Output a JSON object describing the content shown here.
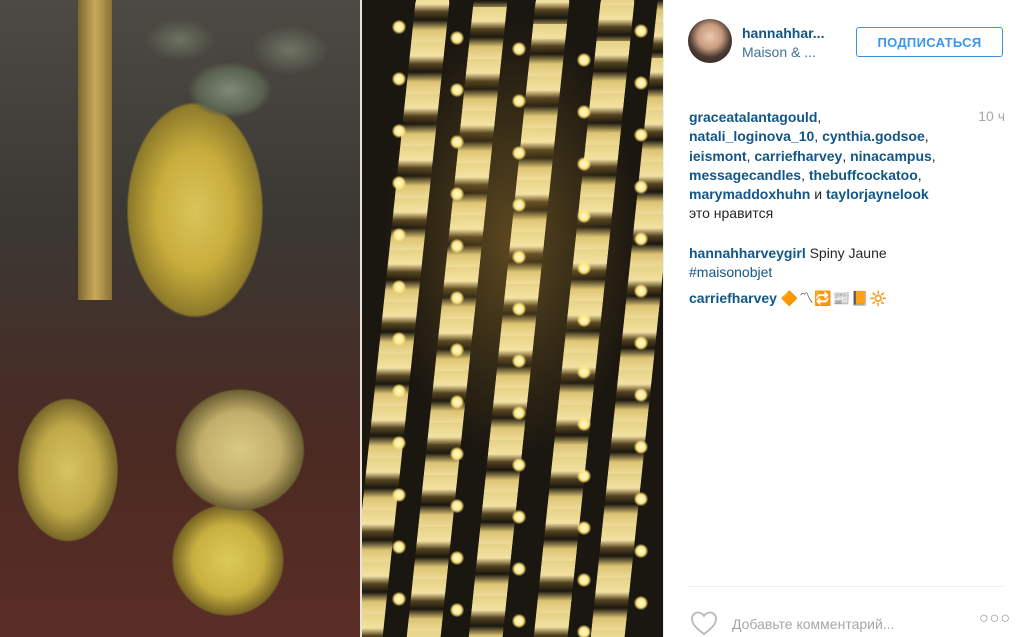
{
  "post": {
    "username": "hannahhar...",
    "location": "Maison & ...",
    "follow_label": "ПОДПИСАТЬСЯ",
    "time": "10 ч"
  },
  "likes": {
    "users": [
      "graceatalantagould",
      "natali_loginova_10",
      "cynthia.godsoe",
      "ieismont",
      "carriefharvey",
      "ninacampus",
      "messagecandles",
      "thebuffcockatoo",
      "marymaddoxhuhn",
      "taylorjaynelook"
    ],
    "and_word": "и",
    "suffix": "это нравится"
  },
  "comments": [
    {
      "user": "hannahharveygirl",
      "text": "Spiny Jaune",
      "hashtag": "#maisonobjet"
    },
    {
      "user": "carriefharvey",
      "text": "🔶〽🔁📰📙🔆"
    }
  ],
  "footer": {
    "comment_placeholder": "Добавьте комментарий...",
    "more_label": "○○○"
  },
  "colors": {
    "link": "#125688",
    "location": "#3f729b",
    "follow": "#3897f0",
    "muted": "#a5a7aa"
  }
}
